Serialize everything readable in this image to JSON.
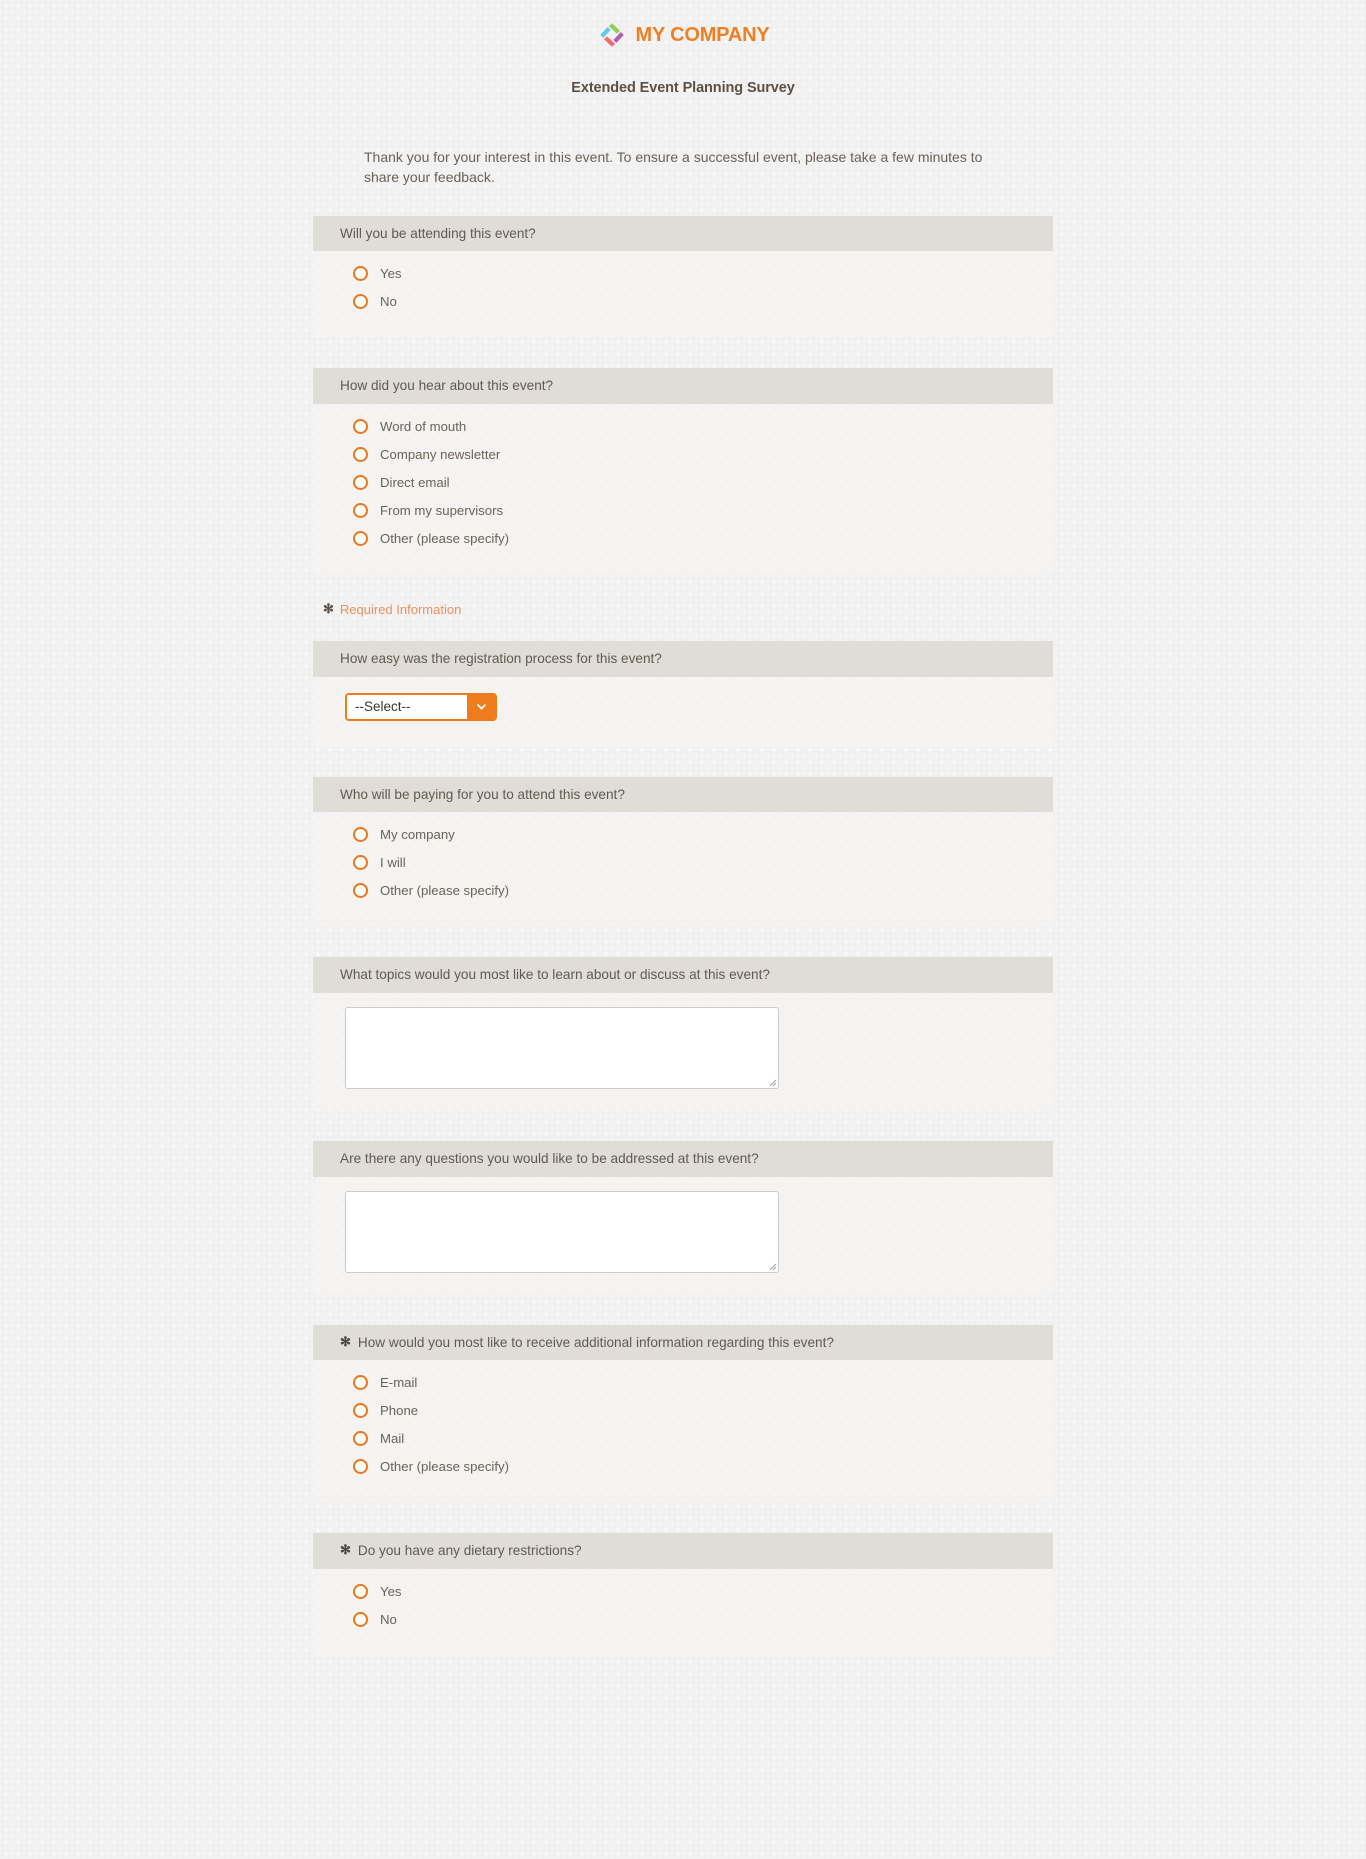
{
  "brand": {
    "name": "MY COMPANY",
    "logo_icon": "pinwheel-diamond-logo",
    "accent_color": "#ee7f22",
    "logo_colors": [
      "#7ec4e8",
      "#8cc63f",
      "#f05a5a",
      "#a64ca6"
    ]
  },
  "header": {
    "title": "Extended Event Planning Survey"
  },
  "intro": {
    "text": "Thank you for your interest in this event. To ensure a successful event, please take a few minutes to share your feedback."
  },
  "required_note": {
    "star": "✻",
    "label": "Required Information",
    "color": "#e8925c"
  },
  "questions": [
    {
      "id": "attending",
      "required": false,
      "star": "",
      "label": "Will you be attending this event?",
      "type": "radio",
      "options": [
        "Yes",
        "No"
      ]
    },
    {
      "id": "how-heard",
      "required": false,
      "star": "",
      "label": "How did you hear about this event?",
      "type": "radio",
      "options": [
        "Word of mouth",
        "Company newsletter",
        "Direct email",
        "From my supervisors",
        "Other (please specify)"
      ]
    },
    {
      "id": "registration-ease",
      "required": false,
      "star": "",
      "label": "How easy was the registration process for this event?",
      "type": "select",
      "select": {
        "value": "--Select--",
        "arrow_icon": "chevron-down-icon"
      }
    },
    {
      "id": "who-pays",
      "required": false,
      "star": "",
      "label": "Who will be paying for you to attend this event?",
      "type": "radio",
      "options": [
        "My company",
        "I will",
        "Other (please specify)"
      ]
    },
    {
      "id": "topics",
      "required": false,
      "star": "",
      "label": "What topics would you most like to learn about or discuss at this event?",
      "type": "textarea",
      "textarea": {
        "value": "",
        "placeholder": ""
      }
    },
    {
      "id": "questions-addressed",
      "required": false,
      "star": "",
      "label": "Are there any questions you would like to be addressed at this event?",
      "type": "textarea",
      "textarea": {
        "value": "",
        "placeholder": ""
      }
    },
    {
      "id": "contact-method",
      "required": true,
      "star": "✻",
      "label": "How would you most like to receive additional information regarding this event?",
      "type": "radio",
      "options": [
        "E-mail",
        "Phone",
        "Mail",
        "Other (please specify)"
      ]
    },
    {
      "id": "dietary",
      "required": true,
      "star": "✻",
      "label": "Do you have any dietary restrictions?",
      "type": "radio",
      "options": [
        "Yes",
        "No"
      ]
    }
  ]
}
